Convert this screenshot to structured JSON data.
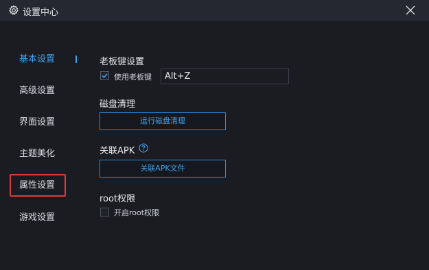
{
  "window": {
    "title": "设置中心",
    "icons": [
      "gear-icon",
      "close-icon"
    ]
  },
  "sidebar": {
    "items": [
      {
        "label": "基本设置",
        "active": true
      },
      {
        "label": "高级设置"
      },
      {
        "label": "界面设置"
      },
      {
        "label": "主题美化"
      },
      {
        "label": "属性设置",
        "highlighted": true
      },
      {
        "label": "游戏设置"
      }
    ]
  },
  "boss_key": {
    "title": "老板键设置",
    "checkbox_label": "使用老板键",
    "checked": true,
    "hotkey_value": "Alt+Z"
  },
  "disk": {
    "title": "磁盘清理",
    "button_label": "运行磁盘清理"
  },
  "apk": {
    "title": "关联APK",
    "button_label": "关联APK文件",
    "help_icon": "question-circle-icon"
  },
  "root": {
    "title": "root权限",
    "checkbox_label": "开启root权限",
    "checked": false
  },
  "colors": {
    "accent": "#3fa0ea",
    "highlight_border": "#d93c3c",
    "background": "#1b1c22",
    "titlebar": "#262831"
  }
}
